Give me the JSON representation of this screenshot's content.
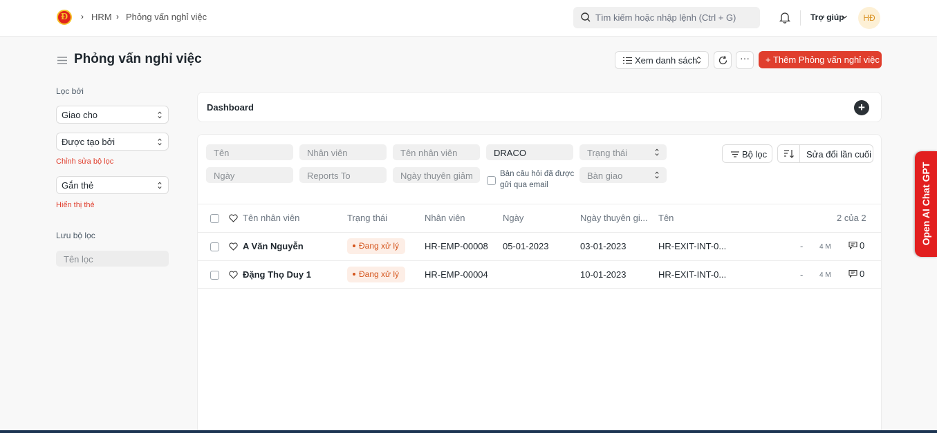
{
  "breadcrumb": {
    "logo_letter": "Đ",
    "items": [
      "HRM",
      "Phỏng vấn nghỉ việc"
    ]
  },
  "search": {
    "placeholder": "Tìm kiếm hoặc nhập lệnh (Ctrl + G)"
  },
  "header": {
    "help_label": "Trợ giúp",
    "avatar_initials": "HĐ"
  },
  "page": {
    "title": "Phỏng vấn nghỉ việc",
    "view_label": "Xem danh sách",
    "more_label": "···",
    "add_label": "+ Thêm Phỏng vấn nghỉ việc"
  },
  "sidebar": {
    "filter_by_label": "Lọc bởi",
    "assigned_to": "Giao cho",
    "created_by": "Được tạo bởi",
    "edit_filters_link": "Chỉnh sửa bộ lọc",
    "tags": "Gắn thẻ",
    "show_tags_link": "Hiển thị thẻ",
    "saved_filters_label": "Lưu bộ lọc",
    "filter_name_placeholder": "Tên lọc"
  },
  "dashboard": {
    "label": "Dashboard",
    "add_icon": "+"
  },
  "filters": {
    "name": "Tên",
    "employee": "Nhân viên",
    "employee_name": "Tên nhân viên",
    "company_value": "DRACO",
    "status": "Trạng thái",
    "date": "Ngày",
    "reports_to": "Reports To",
    "relieving_date": "Ngày thuyên giảm",
    "questionnaire_label": "Bản câu hỏi đã được gửi qua email",
    "handover": "Bàn giao",
    "filter_button": "Bộ lọc",
    "sort_button": "Sửa đổi lần cuối"
  },
  "table": {
    "columns": [
      "Tên nhân viên",
      "Trạng thái",
      "Nhân viên",
      "Ngày",
      "Ngày thuyên gi...",
      "Tên"
    ],
    "count_label": "2 của 2",
    "rows": [
      {
        "employee_name": "A Văn Nguyễn",
        "status": "Đang xử lý",
        "employee": "HR-EMP-00008",
        "date": "05-01-2023",
        "relieving_date": "03-01-2023",
        "name": "HR-EXIT-INT-0...",
        "dash": "-",
        "age": "4 M",
        "comments": "0"
      },
      {
        "employee_name": "Đặng Thọ Duy 1",
        "status": "Đang xử lý",
        "employee": "HR-EMP-00004",
        "date": "",
        "relieving_date": "10-01-2023",
        "name": "HR-EXIT-INT-0...",
        "dash": "-",
        "age": "4 M",
        "comments": "0"
      }
    ]
  },
  "side_widget": {
    "label": "Open AI Chat GPT"
  },
  "colors": {
    "primary": "#e03e2d",
    "badge_bg": "#fdeee6",
    "badge_text": "#d4541b",
    "widget_red": "#e21f1f"
  },
  "icons": [
    "logo-icon",
    "search-icon",
    "bell-icon",
    "chevron-down-icon",
    "hamburger-icon",
    "list-icon",
    "updown-icon",
    "refresh-icon",
    "filter-icon",
    "sort-icon",
    "heart-icon",
    "comment-icon",
    "plus-icon"
  ]
}
